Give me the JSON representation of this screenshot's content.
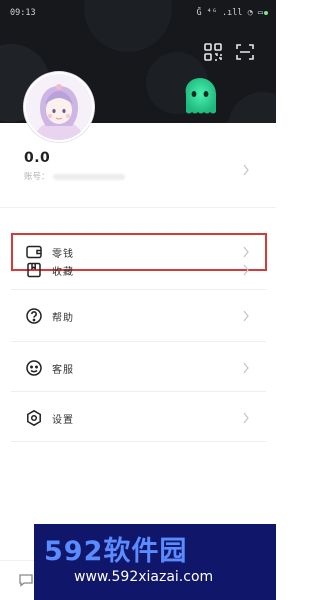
{
  "status_bar": {
    "time": "09:13",
    "icons_text": "Ḡ ⁴ᴳ .ıll ◔ ▭"
  },
  "profile": {
    "name": "0.0",
    "id_label": "账号："
  },
  "menu": [
    {
      "label": "零钱",
      "icon": "wallet-icon",
      "highlighted": true
    },
    {
      "label": "收藏",
      "icon": "bookmark-icon",
      "highlighted": false
    },
    {
      "label": "帮助",
      "icon": "help-icon",
      "highlighted": false
    },
    {
      "label": "客服",
      "icon": "customer-service-icon",
      "highlighted": false
    },
    {
      "label": "设置",
      "icon": "settings-icon",
      "highlighted": false
    }
  ],
  "watermark": {
    "logo": "592软件园",
    "url": "www.592xiazai.com"
  },
  "colors": {
    "header_bg": "#16181c",
    "mascot": "#2ee59d",
    "highlight": "#d83a3a",
    "watermark_bg": "#10166a",
    "watermark_logo": "#5a8cff"
  }
}
